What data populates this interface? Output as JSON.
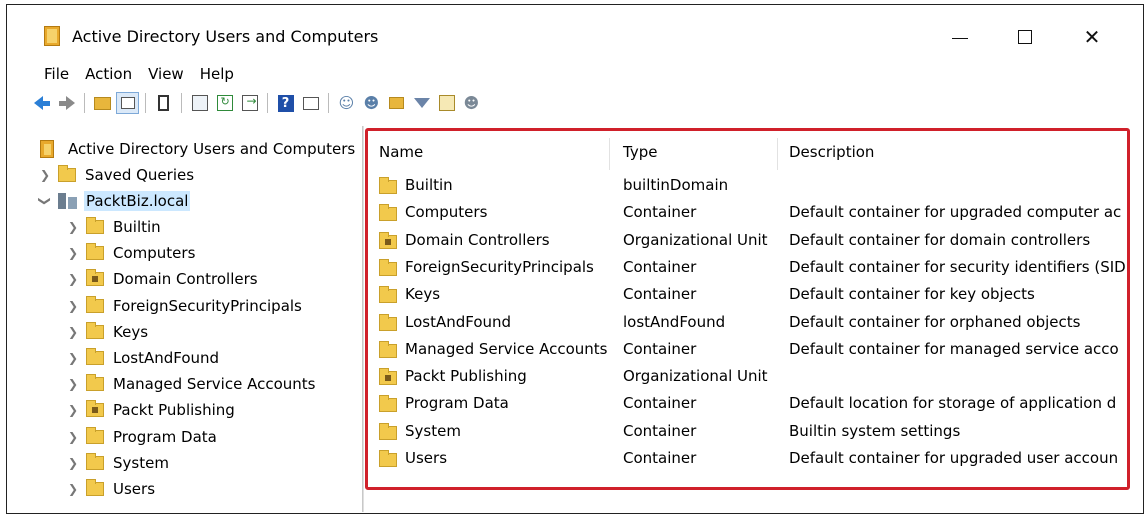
{
  "window": {
    "title": "Active Directory Users and Computers",
    "controls": {
      "minimize": "—",
      "maximize": "☐",
      "close": "✕"
    }
  },
  "menu": [
    "File",
    "Action",
    "View",
    "Help"
  ],
  "toolbar": {
    "icons": [
      "back-arrow-icon",
      "forward-arrow-icon",
      "up-folder-icon",
      "show-hide-console-tree-icon",
      "clipboard-icon",
      "properties-icon",
      "refresh-icon",
      "export-list-icon",
      "help-icon",
      "details-view-icon",
      "new-user-icon",
      "new-group-icon",
      "new-ou-icon",
      "filter-icon",
      "find-icon",
      "add-to-group-icon"
    ]
  },
  "tree": {
    "root": "Active Directory Users and Computers",
    "saved_queries": "Saved Queries",
    "domain": "PacktBiz.local",
    "children": [
      {
        "label": "Builtin",
        "ou": false
      },
      {
        "label": "Computers",
        "ou": false
      },
      {
        "label": "Domain Controllers",
        "ou": true
      },
      {
        "label": "ForeignSecurityPrincipals",
        "ou": false
      },
      {
        "label": "Keys",
        "ou": false
      },
      {
        "label": "LostAndFound",
        "ou": false
      },
      {
        "label": "Managed Service Accounts",
        "ou": false
      },
      {
        "label": "Packt Publishing",
        "ou": true
      },
      {
        "label": "Program Data",
        "ou": false
      },
      {
        "label": "System",
        "ou": false
      },
      {
        "label": "Users",
        "ou": false
      }
    ]
  },
  "list": {
    "columns": {
      "name": "Name",
      "type": "Type",
      "description": "Description"
    },
    "rows": [
      {
        "name": "Builtin",
        "type": "builtinDomain",
        "description": "",
        "ou": false
      },
      {
        "name": "Computers",
        "type": "Container",
        "description": "Default container for upgraded computer ac",
        "ou": false
      },
      {
        "name": "Domain Controllers",
        "type": "Organizational Unit",
        "description": "Default container for domain controllers",
        "ou": true
      },
      {
        "name": "ForeignSecurityPrincipals",
        "type": "Container",
        "description": "Default container for security identifiers (SID",
        "ou": false
      },
      {
        "name": "Keys",
        "type": "Container",
        "description": "Default container for key objects",
        "ou": false
      },
      {
        "name": "LostAndFound",
        "type": "lostAndFound",
        "description": "Default container for orphaned objects",
        "ou": false
      },
      {
        "name": "Managed Service Accounts",
        "type": "Container",
        "description": "Default container for managed service acco",
        "ou": false
      },
      {
        "name": "Packt Publishing",
        "type": "Organizational Unit",
        "description": "",
        "ou": true
      },
      {
        "name": "Program Data",
        "type": "Container",
        "description": "Default location for storage of application d",
        "ou": false
      },
      {
        "name": "System",
        "type": "Container",
        "description": "Builtin system settings",
        "ou": false
      },
      {
        "name": "Users",
        "type": "Container",
        "description": "Default container for upgraded user accoun",
        "ou": false
      }
    ]
  },
  "colors": {
    "highlight_frame": "#d0202a",
    "folder": "#f2c94c",
    "selection": "#cce8ff"
  }
}
